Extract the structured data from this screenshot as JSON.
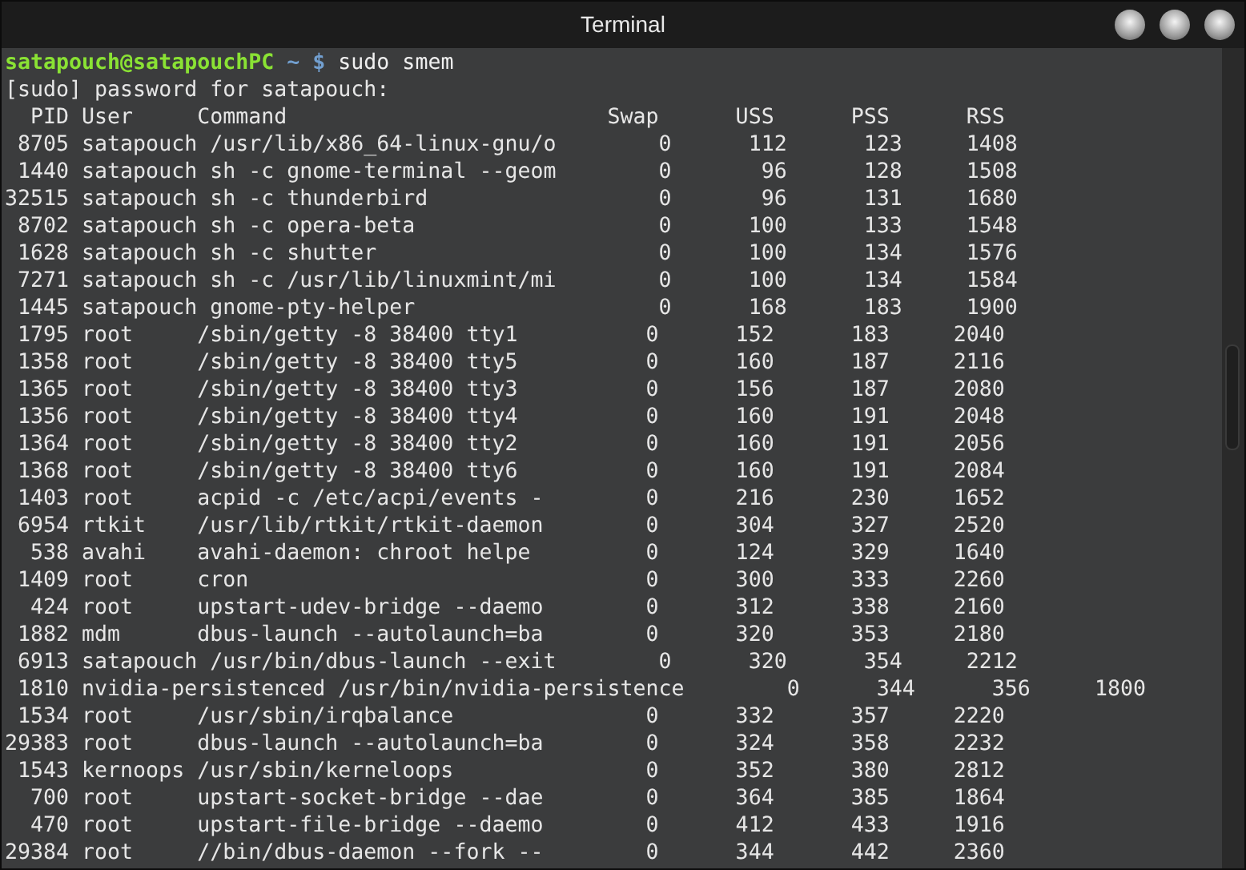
{
  "window": {
    "title": "Terminal"
  },
  "prompt": {
    "user_host": "satapouch@satapouchPC",
    "path": "~",
    "symbol": "$",
    "command": "sudo smem"
  },
  "output_lines": [
    "[sudo] password for satapouch:",
    "  PID User     Command                         Swap      USS      PSS      RSS",
    " 8705 satapouch /usr/lib/x86_64-linux-gnu/o        0      112      123     1408",
    " 1440 satapouch sh -c gnome-terminal --geom        0       96      128     1508",
    "32515 satapouch sh -c thunderbird                  0       96      131     1680",
    " 8702 satapouch sh -c opera-beta                   0      100      133     1548",
    " 1628 satapouch sh -c shutter                      0      100      134     1576",
    " 7271 satapouch sh -c /usr/lib/linuxmint/mi        0      100      134     1584",
    " 1445 satapouch gnome-pty-helper                   0      168      183     1900",
    " 1795 root     /sbin/getty -8 38400 tty1          0      152      183     2040",
    " 1358 root     /sbin/getty -8 38400 tty5          0      160      187     2116",
    " 1365 root     /sbin/getty -8 38400 tty3          0      156      187     2080",
    " 1356 root     /sbin/getty -8 38400 tty4          0      160      191     2048",
    " 1364 root     /sbin/getty -8 38400 tty2          0      160      191     2056",
    " 1368 root     /sbin/getty -8 38400 tty6          0      160      191     2084",
    " 1403 root     acpid -c /etc/acpi/events -        0      216      230     1652",
    " 6954 rtkit    /usr/lib/rtkit/rtkit-daemon        0      304      327     2520",
    "  538 avahi    avahi-daemon: chroot helpe         0      124      329     1640",
    " 1409 root     cron                               0      300      333     2260",
    "  424 root     upstart-udev-bridge --daemo        0      312      338     2160",
    " 1882 mdm      dbus-launch --autolaunch=ba        0      320      353     2180",
    " 6913 satapouch /usr/bin/dbus-launch --exit        0      320      354     2212",
    " 1810 nvidia-persistenced /usr/bin/nvidia-persistence        0      344      356     1800",
    " 1534 root     /usr/sbin/irqbalance               0      332      357     2220",
    "29383 root     dbus-launch --autolaunch=ba        0      324      358     2232",
    " 1543 kernoops /usr/sbin/kerneloops               0      352      380     2812",
    "  700 root     upstart-socket-bridge --dae        0      364      385     1864",
    "  470 root     upstart-file-bridge --daemo        0      412      433     1916",
    "29384 root     //bin/dbus-daemon --fork --        0      344      442     2360"
  ]
}
